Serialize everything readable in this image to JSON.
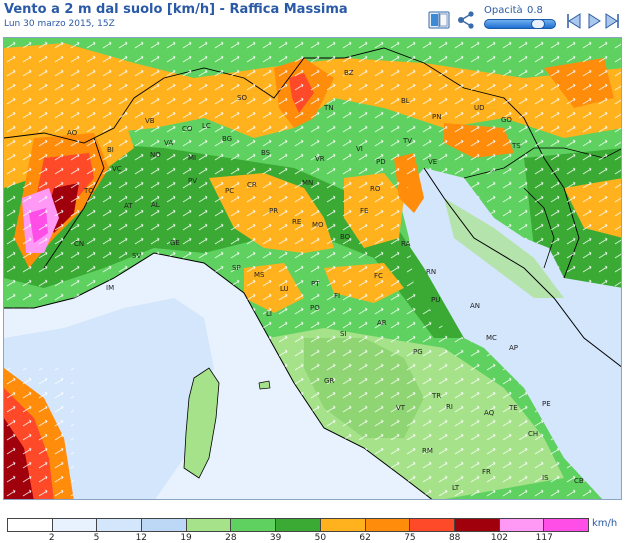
{
  "header": {
    "title": "Vento a 2 m dal suolo [km/h] - Raffica Massima",
    "subtitle": "Lun 30 marzo 2015, 15Z",
    "opacity_label": "Opacità",
    "opacity_value": "0.8",
    "opacity": 0.8
  },
  "icons": {
    "book": "book-icon",
    "share": "share-icon",
    "prev": "arrow-left-icon",
    "play": "play-icon",
    "next": "arrow-right-icon"
  },
  "map": {
    "cities": [
      "BZ",
      "SO",
      "TN",
      "BL",
      "UD",
      "PN",
      "GO",
      "VB",
      "CO",
      "LC",
      "BG",
      "BS",
      "VR",
      "VI",
      "TV",
      "VE",
      "TS",
      "BI",
      "VA",
      "MI",
      "AO",
      "NO",
      "PD",
      "TO",
      "VC",
      "PV",
      "CR",
      "MN",
      "RO",
      "AT",
      "AL",
      "PC",
      "PR",
      "RE",
      "MO",
      "FE",
      "CN",
      "GE",
      "BO",
      "RA",
      "SV",
      "SP",
      "MS",
      "FC",
      "RN",
      "IM",
      "LU",
      "PT",
      "FI",
      "PU",
      "PO",
      "LI",
      "AR",
      "SI",
      "AN",
      "MC",
      "PG",
      "GR",
      "AP",
      "TR",
      "RI",
      "TE",
      "VT",
      "AQ",
      "PE",
      "CH",
      "RM",
      "FR",
      "IS",
      "LT",
      "CB"
    ]
  },
  "legend": {
    "unit": "km/h",
    "ticks": [
      "2",
      "5",
      "12",
      "19",
      "28",
      "39",
      "50",
      "62",
      "75",
      "88",
      "102",
      "117"
    ],
    "colors": [
      "#ffffff",
      "#e8f2fe",
      "#d4e6fb",
      "#bcd8f6",
      "#a6e28a",
      "#5fd160",
      "#3aaa35",
      "#ffb21d",
      "#ff8c0b",
      "#ff4a2a",
      "#a0000c",
      "#ff99f5",
      "#ff4de8"
    ]
  }
}
